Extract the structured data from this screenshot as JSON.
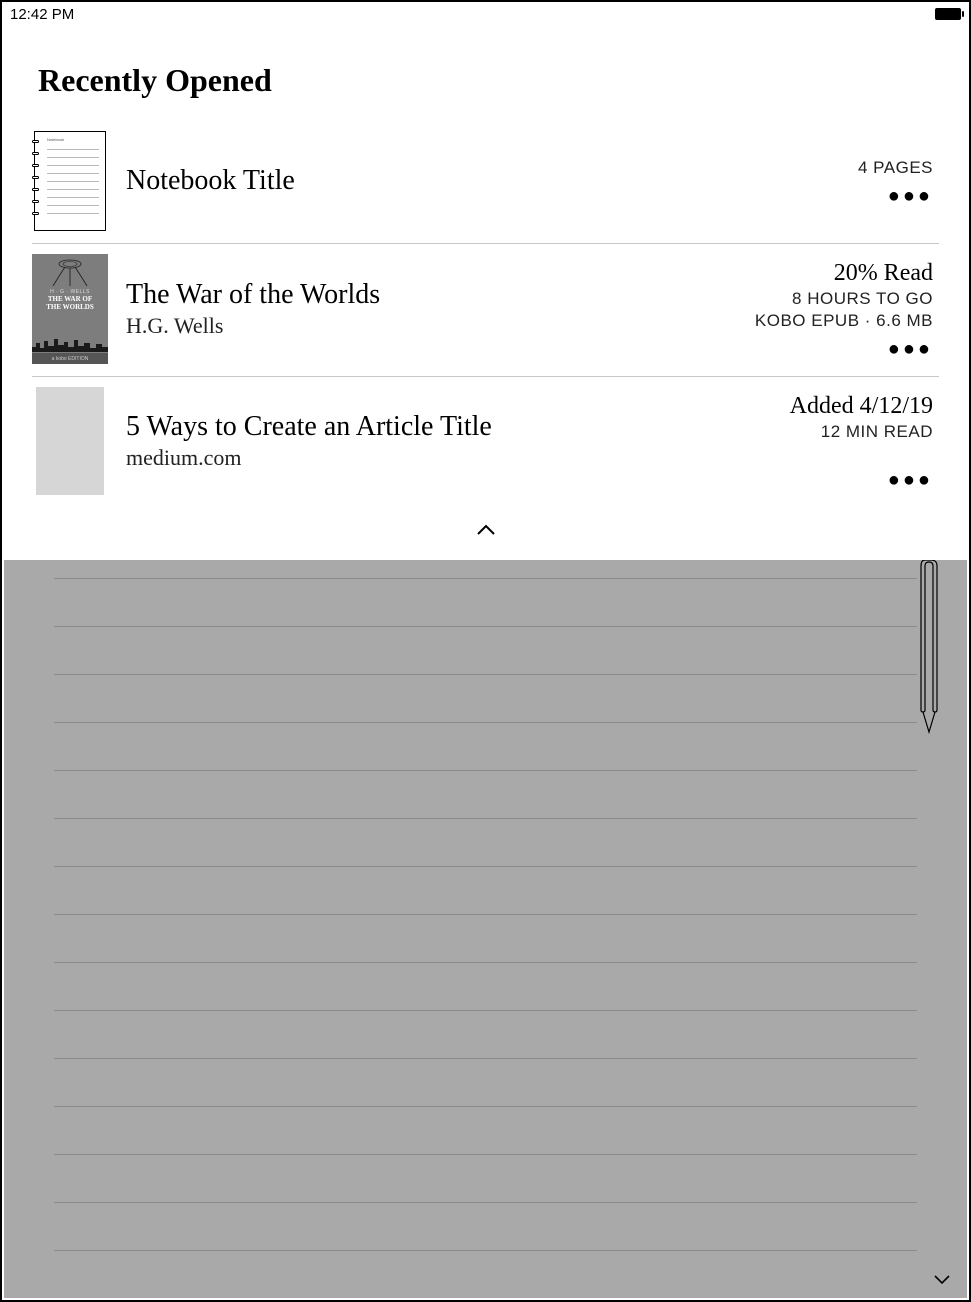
{
  "status": {
    "time": "12:42 PM"
  },
  "section_title": "Recently Opened",
  "items": [
    {
      "title": "Notebook Title",
      "subtitle": "",
      "meta_primary": "",
      "meta_secondary": "4 PAGES",
      "meta_tertiary": ""
    },
    {
      "title": "The War of the Worlds",
      "subtitle": "H.G. Wells",
      "meta_primary": "20% Read",
      "meta_secondary": "8 HOURS TO GO",
      "meta_tertiary": "KOBO EPUB · 6.6 MB",
      "cover": {
        "author": "H · G · WELLS",
        "title_line1": "THE WAR OF",
        "title_line2": "THE WORLDS",
        "tag": "a kobo EDITION"
      }
    },
    {
      "title": "5 Ways to Create an Article Title",
      "subtitle": "medium.com",
      "meta_primary": "Added 4/12/19",
      "meta_secondary": "12 MIN READ",
      "meta_tertiary": ""
    }
  ]
}
